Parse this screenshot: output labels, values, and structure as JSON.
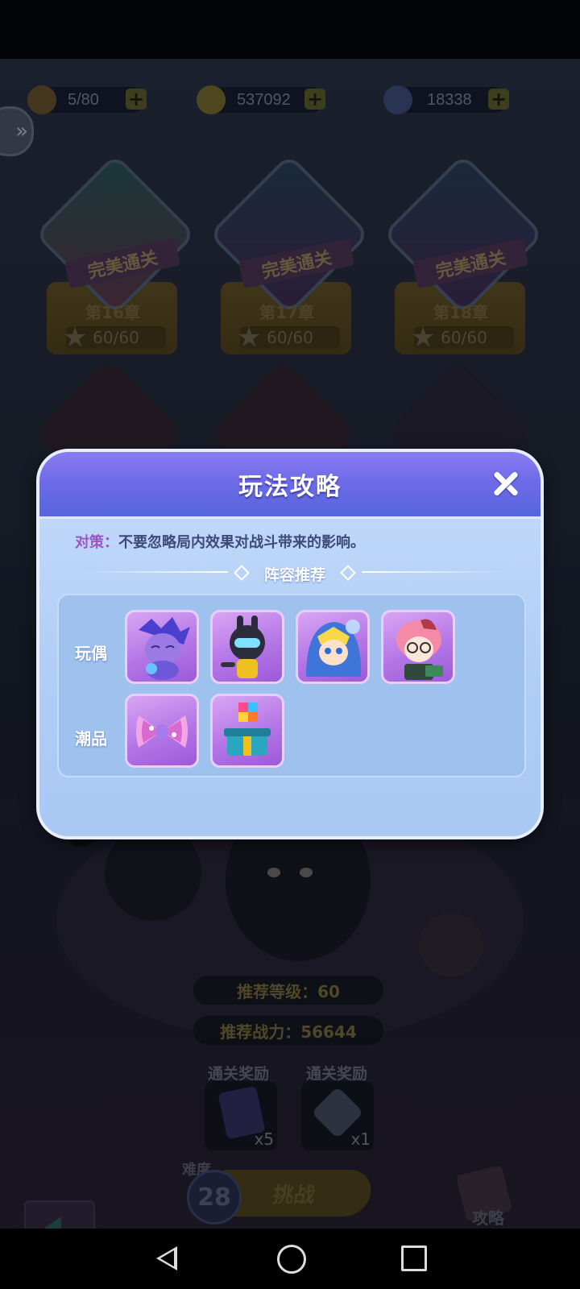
{
  "resources": [
    {
      "name": "energy-icon",
      "value": "5/80",
      "color": "#b08a3a"
    },
    {
      "name": "coin-icon",
      "value": "537092",
      "color": "#8d7a2c"
    },
    {
      "name": "diamond-icon",
      "value": "18338",
      "color": "#5a6fa8"
    }
  ],
  "plus_glyph": "+",
  "side_tab_glyph": "»",
  "chapters": [
    {
      "badge": "完美通关",
      "name": "第16章",
      "stars": "60/60"
    },
    {
      "badge": "完美通关",
      "name": "第17章",
      "stars": "60/60"
    },
    {
      "badge": "完美通关",
      "name": "第18章",
      "stars": "60/60"
    }
  ],
  "stage": {
    "recommended_level": "推荐等级：60",
    "recommended_power": "推荐战力：56644",
    "reward_label_1": "通关奖励",
    "reward_label_2": "通关奖励",
    "reward_1_count": "x5",
    "reward_2_count": "x1",
    "reward_1_icon": "play-card-icon",
    "reward_2_icon": "mystery-box-icon",
    "difficulty_label": "难度",
    "difficulty": "28",
    "challenge_label": "挑战",
    "guide_label": "攻略"
  },
  "modal": {
    "title": "玩法攻略",
    "strategy_key": "对策：",
    "strategy_text": "不要忽略局内效果对战斗带来的影响。",
    "lineup_title": "阵容推荐",
    "dolls_label": "玩偶",
    "trends_label": "潮品",
    "dolls": [
      {
        "icon": "sleepy-dragon-doll-icon"
      },
      {
        "icon": "robot-bunny-doll-icon"
      },
      {
        "icon": "blue-hood-boy-doll-icon"
      },
      {
        "icon": "pink-hair-girl-doll-icon"
      }
    ],
    "trends": [
      {
        "icon": "bow-tie-icon"
      },
      {
        "icon": "cube-gift-box-icon"
      }
    ]
  },
  "colors": {
    "modal_header": "#6f6be8",
    "modal_body": "#b0cdf6",
    "strategy_key": "#a053c4",
    "item_bg": "#b476e6"
  }
}
